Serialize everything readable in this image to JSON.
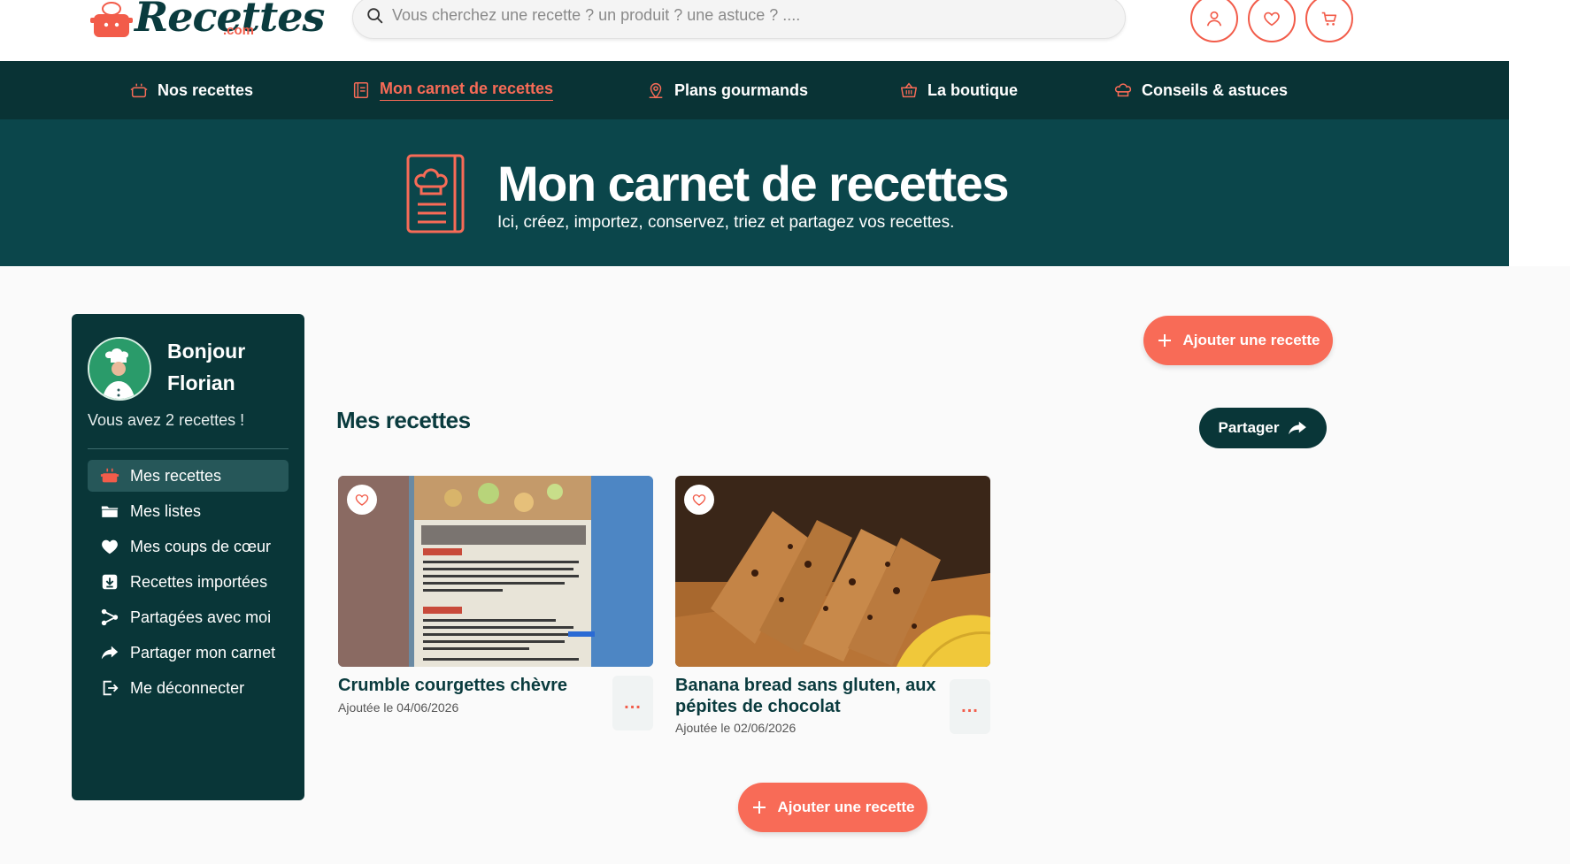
{
  "header": {
    "logo_text": "Recettes",
    "logo_suffix": ".com",
    "search_placeholder": "Vous cherchez une recette ? un produit ? une astuce ? ...."
  },
  "nav": {
    "items": [
      {
        "label": "Nos recettes",
        "icon": "pot-icon"
      },
      {
        "label": "Mon carnet de recettes",
        "icon": "notebook-icon",
        "active": true
      },
      {
        "label": "Plans gourmands",
        "icon": "map-pin-icon"
      },
      {
        "label": "La boutique",
        "icon": "basket-icon"
      },
      {
        "label": "Conseils & astuces",
        "icon": "chef-hat-icon"
      }
    ]
  },
  "hero": {
    "title": "Mon carnet de recettes",
    "subtitle": "Ici, créez, importez, conservez, triez et partagez vos recettes."
  },
  "sidebar": {
    "greeting_line1": "Bonjour",
    "greeting_line2": "Florian",
    "recipe_count": "Vous avez 2 recettes !",
    "items": [
      {
        "label": "Mes recettes",
        "icon": "pot-icon",
        "active": true
      },
      {
        "label": "Mes listes",
        "icon": "folder-icon"
      },
      {
        "label": "Mes coups de cœur",
        "icon": "heart-icon"
      },
      {
        "label": "Recettes importées",
        "icon": "import-icon"
      },
      {
        "label": "Partagées avec moi",
        "icon": "share-nodes-icon"
      },
      {
        "label": "Partager mon carnet",
        "icon": "share-arrow-icon"
      },
      {
        "label": "Me déconnecter",
        "icon": "logout-icon"
      }
    ]
  },
  "main": {
    "section_title": "Mes recettes",
    "add_button": "Ajouter une recette",
    "share_button": "Partager",
    "add_button_bottom": "Ajouter une recette",
    "cards": [
      {
        "title": "Crumble courgettes chèvre",
        "date": "Ajoutée le 04/06/2026",
        "more": "..."
      },
      {
        "title": "Banana bread sans gluten, aux pépites de chocolat",
        "date": "Ajoutée le 02/06/2026",
        "more": "..."
      }
    ]
  },
  "colors": {
    "accent": "#f86b57",
    "dark_teal": "#093335",
    "hero_teal": "#0b464b"
  }
}
